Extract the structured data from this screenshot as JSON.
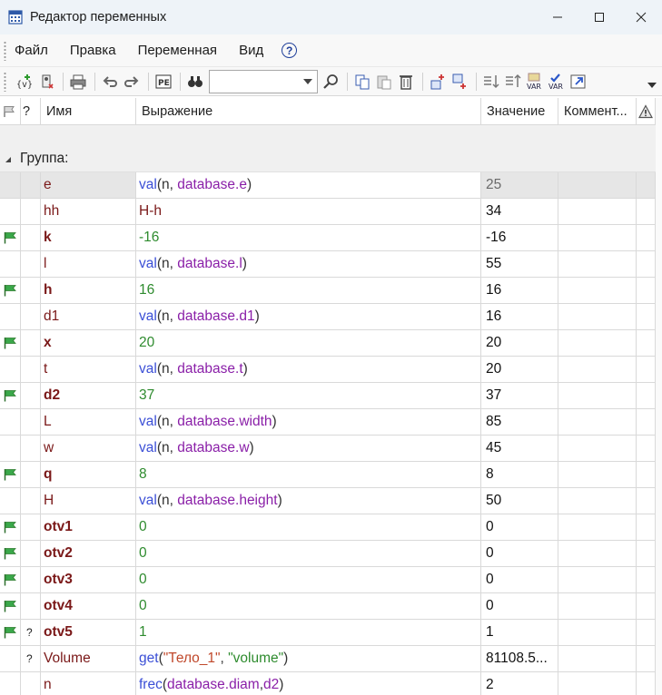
{
  "window": {
    "title": "Редактор переменных",
    "controls": [
      "minimize",
      "maximize",
      "close"
    ]
  },
  "menu": [
    {
      "label": "Файл"
    },
    {
      "label": "Правка"
    },
    {
      "label": "Переменная"
    },
    {
      "label": "Вид"
    }
  ],
  "help": {
    "label": "?"
  },
  "toolbar": {
    "search": {
      "value": "",
      "placeholder": ""
    },
    "buttons": [
      "add-variable-icon",
      "delete-variable-icon",
      "print-icon",
      "undo-icon",
      "redo-icon",
      "parameters-icon",
      "find-icon",
      "search-go-icon",
      "copy-icon",
      "paste-icon",
      "delete-icon",
      "insert-above-icon",
      "insert-below-icon",
      "sort-down-icon",
      "sort-up-icon",
      "var-icon",
      "var-check-icon",
      "external-link-icon"
    ]
  },
  "columns": {
    "flag": "",
    "q": "?",
    "name": "Имя",
    "expr": "Выражение",
    "value": "Значение",
    "comment": "Коммент...",
    "warn": ""
  },
  "group": {
    "label": "Группа:"
  },
  "rows": [
    {
      "flag": false,
      "q": "",
      "name": "e",
      "value": "25",
      "comment": "",
      "expr": [
        {
          "t": "val",
          "k": "fn"
        },
        {
          "t": "(n, ",
          "k": "p"
        },
        {
          "t": "database.e",
          "k": "var"
        },
        {
          "t": ")",
          "k": "p"
        }
      ]
    },
    {
      "flag": false,
      "q": "",
      "name": "hh",
      "value": "34",
      "comment": "",
      "expr": [
        {
          "t": "H-h",
          "k": "plain"
        }
      ]
    },
    {
      "flag": true,
      "q": "",
      "name": "k",
      "value": "-16",
      "comment": "",
      "expr": [
        {
          "t": "-16",
          "k": "num"
        }
      ]
    },
    {
      "flag": false,
      "q": "",
      "name": "l",
      "value": "55",
      "comment": "",
      "expr": [
        {
          "t": "val",
          "k": "fn"
        },
        {
          "t": "(n, ",
          "k": "p"
        },
        {
          "t": "database.l",
          "k": "var"
        },
        {
          "t": ")",
          "k": "p"
        }
      ]
    },
    {
      "flag": true,
      "q": "",
      "name": "h",
      "value": "16",
      "comment": "",
      "expr": [
        {
          "t": "16",
          "k": "num"
        }
      ]
    },
    {
      "flag": false,
      "q": "",
      "name": "d1",
      "value": "16",
      "comment": "",
      "expr": [
        {
          "t": "val",
          "k": "fn"
        },
        {
          "t": "(n, ",
          "k": "p"
        },
        {
          "t": "database.d1",
          "k": "var"
        },
        {
          "t": ")",
          "k": "p"
        }
      ]
    },
    {
      "flag": true,
      "q": "",
      "name": "x",
      "value": "20",
      "comment": "",
      "expr": [
        {
          "t": "20",
          "k": "num"
        }
      ]
    },
    {
      "flag": false,
      "q": "",
      "name": "t",
      "value": "20",
      "comment": "",
      "expr": [
        {
          "t": "val",
          "k": "fn"
        },
        {
          "t": "(n, ",
          "k": "p"
        },
        {
          "t": "database.t",
          "k": "var"
        },
        {
          "t": ")",
          "k": "p"
        }
      ]
    },
    {
      "flag": true,
      "q": "",
      "name": "d2",
      "value": "37",
      "comment": "",
      "expr": [
        {
          "t": "37",
          "k": "num"
        }
      ]
    },
    {
      "flag": false,
      "q": "",
      "name": "L",
      "value": "85",
      "comment": "",
      "expr": [
        {
          "t": "val",
          "k": "fn"
        },
        {
          "t": "(n, ",
          "k": "p"
        },
        {
          "t": "database.width",
          "k": "var"
        },
        {
          "t": ")",
          "k": "p"
        }
      ]
    },
    {
      "flag": false,
      "q": "",
      "name": "w",
      "value": "45",
      "comment": "",
      "expr": [
        {
          "t": "val",
          "k": "fn"
        },
        {
          "t": "(n, ",
          "k": "p"
        },
        {
          "t": "database.w",
          "k": "var"
        },
        {
          "t": ")",
          "k": "p"
        }
      ]
    },
    {
      "flag": true,
      "q": "",
      "name": "q",
      "value": "8",
      "comment": "",
      "expr": [
        {
          "t": "8",
          "k": "num"
        }
      ]
    },
    {
      "flag": false,
      "q": "",
      "name": "H",
      "value": "50",
      "comment": "",
      "expr": [
        {
          "t": "val",
          "k": "fn"
        },
        {
          "t": "(n, ",
          "k": "p"
        },
        {
          "t": "database.height",
          "k": "var"
        },
        {
          "t": ")",
          "k": "p"
        }
      ]
    },
    {
      "flag": true,
      "q": "",
      "name": "otv1",
      "value": "0",
      "comment": "",
      "expr": [
        {
          "t": "0",
          "k": "num"
        }
      ]
    },
    {
      "flag": true,
      "q": "",
      "name": "otv2",
      "value": "0",
      "comment": "",
      "expr": [
        {
          "t": "0",
          "k": "num"
        }
      ]
    },
    {
      "flag": true,
      "q": "",
      "name": "otv3",
      "value": "0",
      "comment": "",
      "expr": [
        {
          "t": "0",
          "k": "num"
        }
      ]
    },
    {
      "flag": true,
      "q": "",
      "name": "otv4",
      "value": "0",
      "comment": "",
      "expr": [
        {
          "t": "0",
          "k": "num"
        }
      ]
    },
    {
      "flag": true,
      "q": "?",
      "name": "otv5",
      "value": "1",
      "comment": "",
      "expr": [
        {
          "t": "1",
          "k": "num"
        }
      ]
    },
    {
      "flag": false,
      "q": "?",
      "name": "Volume",
      "value": "81108.5...",
      "comment": "",
      "expr": [
        {
          "t": "get",
          "k": "fn"
        },
        {
          "t": "(",
          "k": "p"
        },
        {
          "t": "\"Тело_1\"",
          "k": "strr"
        },
        {
          "t": ", ",
          "k": "p"
        },
        {
          "t": "\"volume\"",
          "k": "str"
        },
        {
          "t": ")",
          "k": "p"
        }
      ]
    },
    {
      "flag": false,
      "q": "",
      "name": "n",
      "value": "2",
      "comment": "",
      "expr": [
        {
          "t": "frec",
          "k": "fn"
        },
        {
          "t": "(",
          "k": "p"
        },
        {
          "t": "database.diam",
          "k": "var"
        },
        {
          "t": ",",
          "k": "p"
        },
        {
          "t": "d2",
          "k": "var"
        },
        {
          "t": ")",
          "k": "p"
        }
      ]
    }
  ],
  "selected_row": 0,
  "colors": {
    "titlebar": "#eef3f8",
    "name": "#7a1818",
    "function": "#3b4fd6",
    "variable": "#8a1fa8",
    "number": "#2e8b2e",
    "flag": "#3aa84a"
  }
}
